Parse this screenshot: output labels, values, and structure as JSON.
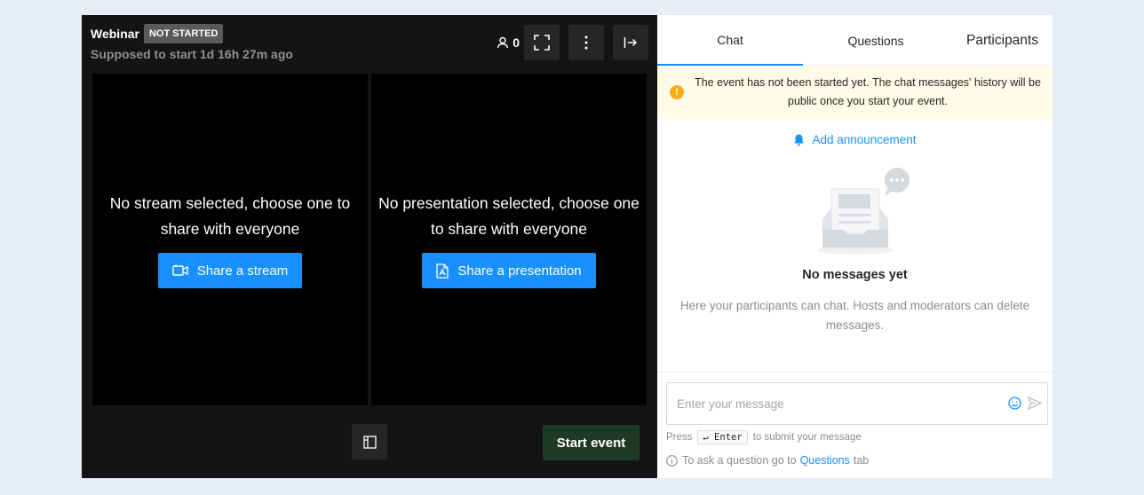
{
  "header": {
    "title": "Webinar",
    "status": "NOT STARTED",
    "subtitle": "Supposed to start 1d 16h 27m ago",
    "participant_count": "0"
  },
  "stage": {
    "stream_panel": {
      "message": "No stream selected, choose one to share with everyone",
      "button_label": "Share a stream"
    },
    "presentation_panel": {
      "message": "No presentation selected, choose one to share with everyone",
      "button_label": "Share a presentation"
    },
    "start_label": "Start event"
  },
  "sidebar": {
    "tabs": [
      {
        "label": "Chat",
        "active": true
      },
      {
        "label": "Questions",
        "active": false
      },
      {
        "label": "Participants",
        "active": false
      }
    ],
    "notice": "The event has not been started yet. The chat messages' history will be public once you start your event.",
    "announcement_label": "Add announcement",
    "empty_title": "No messages yet",
    "empty_desc": "Here your participants can chat. Hosts and moderators can delete messages.",
    "composer": {
      "placeholder": "Enter your message",
      "value": ""
    },
    "hint_press": "Press",
    "hint_key": "↵ Enter",
    "hint_suffix": "to submit your message",
    "question_hint_prefix": "To ask a question go to",
    "question_hint_link": "Questions",
    "question_hint_suffix": "tab"
  },
  "colors": {
    "accent": "#1890ff",
    "start_button": "#1f3a24",
    "warning": "#faad14",
    "notice_bg": "#fffbe6"
  }
}
